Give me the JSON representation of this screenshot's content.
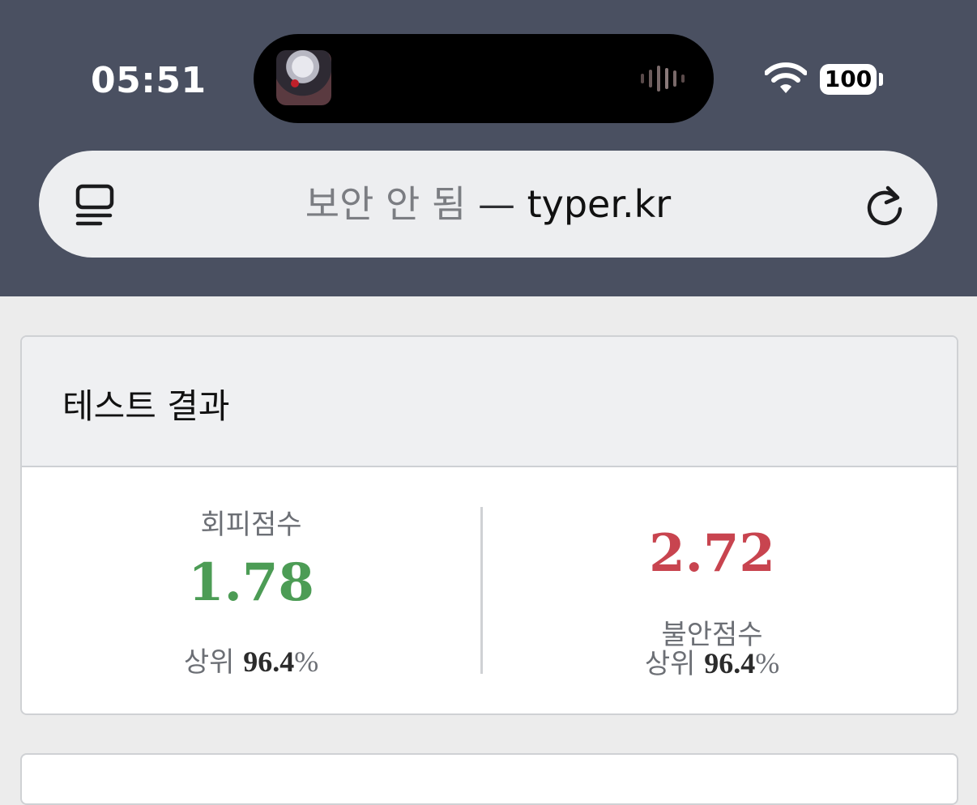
{
  "status_bar": {
    "time": "05:51",
    "battery": "100",
    "wifi_icon": "wifi-icon",
    "media_icon": "audio-waveform-icon"
  },
  "address_bar": {
    "insecure_label": "보안 안 됨",
    "separator": "—",
    "domain": "typer.kr",
    "left_icon": "tabs-menu-icon",
    "right_icon": "reload-icon"
  },
  "result_card": {
    "title": "테스트 결과",
    "avoidance": {
      "label": "회피점수",
      "score": "1.78",
      "rank_prefix": "상위",
      "rank_value": "96.4",
      "rank_suffix": "%"
    },
    "anxiety": {
      "score": "2.72",
      "label": "불안점수",
      "rank_prefix": "상위",
      "rank_value": "96.4",
      "rank_suffix": "%"
    }
  },
  "colors": {
    "header_bg": "#4a5061",
    "avoidance_score": "#4c9c55",
    "anxiety_score": "#c8444f"
  }
}
